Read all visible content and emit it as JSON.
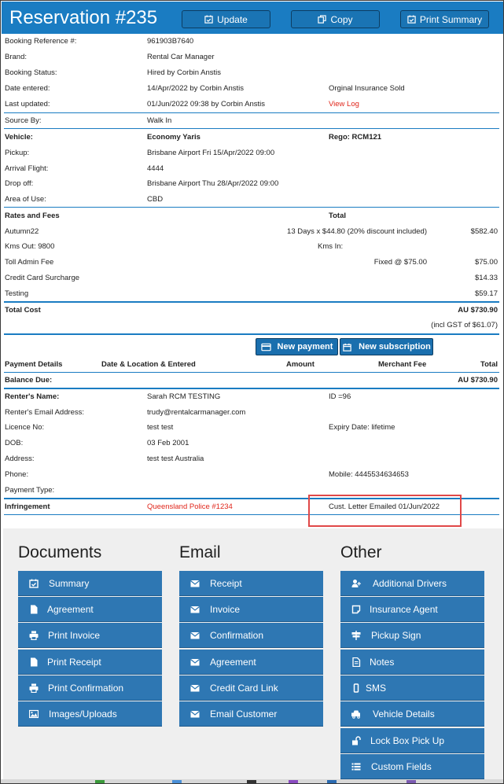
{
  "header": {
    "title": "Reservation #235",
    "update_label": "Update",
    "copy_label": "Copy",
    "print_summary_label": "Print Summary"
  },
  "booking": {
    "ref_label": "Booking Reference #:",
    "ref_value": "961903B7640",
    "brand_label": "Brand:",
    "brand_value": "Rental Car Manager",
    "status_label": "Booking Status:",
    "status_value": "Hired by Corbin Anstis",
    "entered_label": "Date entered:",
    "entered_value": "14/Apr/2022 by Corbin Anstis",
    "insurance_note": "Orginal Insurance Sold",
    "updated_label": "Last updated:",
    "updated_value": "01/Jun/2022 09:38 by Corbin Anstis",
    "view_log": "View Log",
    "source_label": "Source By:",
    "source_value": "Walk In"
  },
  "vehicle": {
    "vehicle_label": "Vehicle:",
    "vehicle_value": "Economy Yaris",
    "rego": "Rego: RCM121",
    "pickup_label": "Pickup:",
    "pickup_value": "Brisbane Airport Fri 15/Apr/2022 09:00",
    "flight_label": "Arrival Flight:",
    "flight_value": "4444",
    "dropoff_label": "Drop off:",
    "dropoff_value": "Brisbane Airport Thu 28/Apr/2022 09:00",
    "area_label": "Area of Use:",
    "area_value": "CBD"
  },
  "rates": {
    "header": "Rates and Fees",
    "total_header": "Total",
    "autumn_label": "Autumn22",
    "autumn_calc": "13 Days x $44.80 (20% discount included)",
    "autumn_total": "$582.40",
    "kms_out": "Kms Out: 9800",
    "kms_in": "Kms In:",
    "toll_label": "Toll Admin Fee",
    "toll_calc": "Fixed @ $75.00",
    "toll_total": "$75.00",
    "cc_label": "Credit Card Surcharge",
    "cc_total": "$14.33",
    "testing_label": "Testing",
    "testing_total": "$59.17",
    "total_cost_label": "Total Cost",
    "total_cost_value": "AU $730.90",
    "gst_note": "(incl GST of $61.07)"
  },
  "payments": {
    "new_payment_label": "New payment",
    "new_subscription_label": "New subscription",
    "columns": [
      "Payment Details",
      "Date & Location & Entered",
      "Amount",
      "Merchant Fee",
      "Total"
    ],
    "balance_label": "Balance Due:",
    "balance_value": "AU $730.90"
  },
  "renter": {
    "name_label": "Renter's Name:",
    "name_value": "Sarah RCM TESTING",
    "id_value": "ID =96",
    "email_label": "Renter's Email Address:",
    "email_value": "trudy@rentalcarmanager.com",
    "licence_label": "Licence No:",
    "licence_value": "test test",
    "expiry_value": "Expiry Date: lifetime",
    "dob_label": "DOB:",
    "dob_value": "03 Feb 2001",
    "address_label": "Address:",
    "address_value": "test test Australia",
    "phone_label": "Phone:",
    "mobile_value": "Mobile: 4445534634653",
    "payment_type_label": "Payment Type:"
  },
  "infringement": {
    "label": "Infringement",
    "link": "Queensland Police #1234",
    "note": "Cust. Letter Emailed 01/Jun/2022"
  },
  "documents": {
    "heading": "Documents",
    "items": [
      {
        "label": "Summary",
        "icon": "calendar-check-icon"
      },
      {
        "label": "Agreement",
        "icon": "file-icon"
      },
      {
        "label": "Print Invoice",
        "icon": "printer-icon"
      },
      {
        "label": "Print Receipt",
        "icon": "file-icon"
      },
      {
        "label": "Print Confirmation",
        "icon": "printer-icon"
      },
      {
        "label": "Images/Uploads",
        "icon": "image-icon"
      }
    ]
  },
  "email": {
    "heading": "Email",
    "items": [
      {
        "label": "Receipt",
        "icon": "envelope-icon"
      },
      {
        "label": "Invoice",
        "icon": "envelope-icon"
      },
      {
        "label": "Confirmation",
        "icon": "envelope-icon"
      },
      {
        "label": "Agreement",
        "icon": "envelope-icon"
      },
      {
        "label": "Credit Card Link",
        "icon": "envelope-icon"
      },
      {
        "label": "Email Customer",
        "icon": "envelope-icon"
      }
    ]
  },
  "other": {
    "heading": "Other",
    "items": [
      {
        "label": "Additional Drivers",
        "icon": "user-plus-icon"
      },
      {
        "label": "Insurance Agent",
        "icon": "note-icon"
      },
      {
        "label": "Pickup Sign",
        "icon": "sign-icon"
      },
      {
        "label": "Notes",
        "icon": "file-text-icon"
      },
      {
        "label": "SMS",
        "icon": "mobile-icon"
      },
      {
        "label": "Vehicle Details",
        "icon": "car-icon"
      },
      {
        "label": "Lock Box Pick Up",
        "icon": "unlock-icon"
      },
      {
        "label": "Custom Fields",
        "icon": "list-icon"
      }
    ]
  },
  "colors": {
    "accent": "#1a7cc2",
    "button": "#2e77b3",
    "link_red": "#e0261b",
    "highlight": "#e04848"
  }
}
